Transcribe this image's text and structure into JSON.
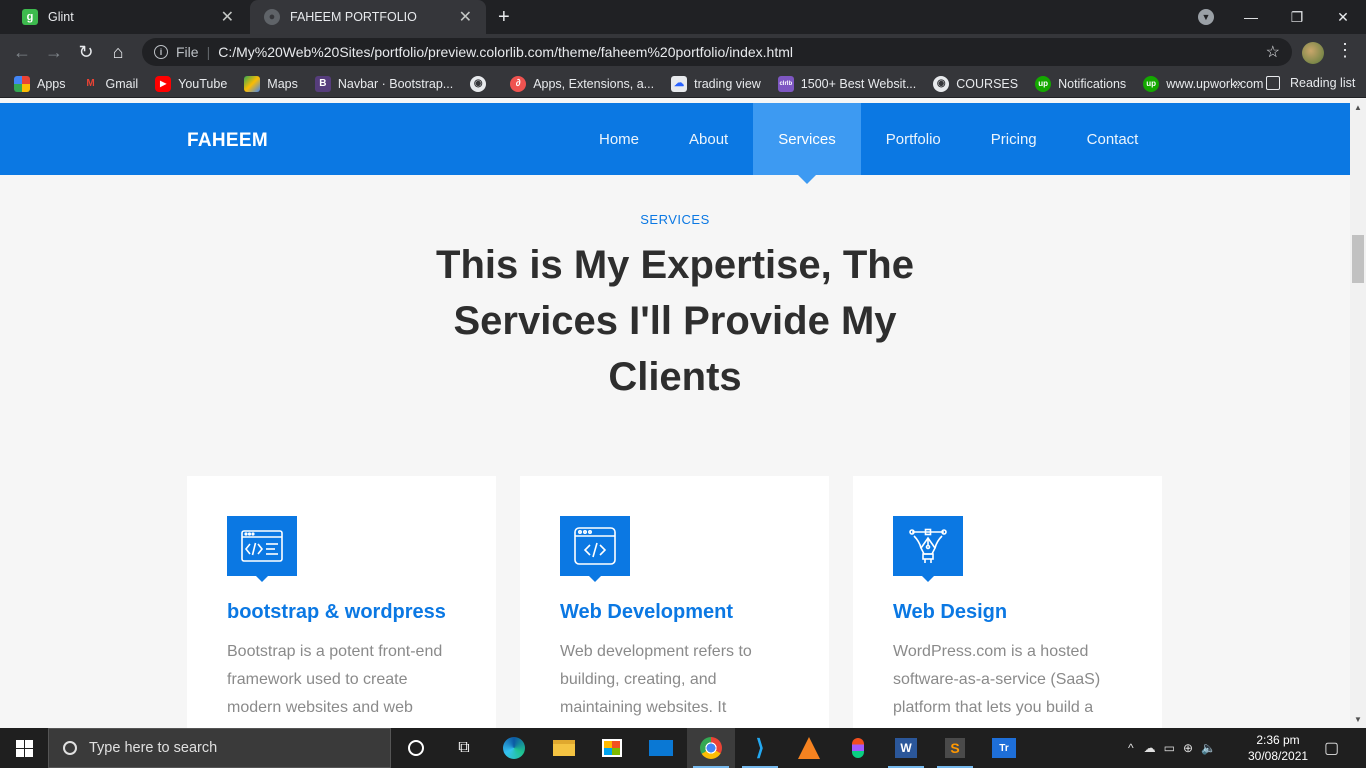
{
  "browser": {
    "tabs": [
      {
        "title": "Glint",
        "favicon": "g"
      },
      {
        "title": "FAHEEM PORTFOLIO"
      }
    ],
    "new_tab": "+",
    "window_controls": {
      "minimize": "—",
      "restore": "❐",
      "close": "✕"
    },
    "address": {
      "scheme_label": "File",
      "url": "C:/My%20Web%20Sites/portfolio/preview.colorlib.com/theme/faheem%20portfolio/index.html"
    },
    "bookmarks": [
      {
        "label": "Apps",
        "icon": "apps-grid-icon"
      },
      {
        "label": "Gmail",
        "icon": "gmail-icon"
      },
      {
        "label": "YouTube",
        "icon": "youtube-icon"
      },
      {
        "label": "Maps",
        "icon": "maps-icon"
      },
      {
        "label": "Navbar · Bootstrap...",
        "icon": "bootstrap-icon"
      },
      {
        "label": "",
        "icon": "globe-icon"
      },
      {
        "label": "Apps, Extensions, a...",
        "icon": "extensions-icon"
      },
      {
        "label": "trading view",
        "icon": "tradingview-icon"
      },
      {
        "label": "1500+ Best Websit...",
        "icon": "colorlib-icon"
      },
      {
        "label": "COURSES",
        "icon": "globe-icon"
      },
      {
        "label": "Notifications",
        "icon": "upwork-icon"
      },
      {
        "label": "www.upwork.com",
        "icon": "upwork-icon"
      }
    ],
    "bookmarks_more": "»",
    "reading_list": "Reading list"
  },
  "site": {
    "brand": "FAHEEM",
    "nav": [
      "Home",
      "About",
      "Services",
      "Portfolio",
      "Pricing",
      "Contact"
    ],
    "active_nav": "Services",
    "section_label": "SERVICES",
    "section_title": "This is My Expertise, The Services I'll Provide My Clients",
    "cards": [
      {
        "title": "bootstrap & wordpress",
        "text": "Bootstrap is a potent front-end framework used to create modern websites and web",
        "icon": "code-window-icon"
      },
      {
        "title": "Web Development",
        "text": "Web development refers to building, creating, and maintaining websites. It",
        "icon": "browser-code-icon"
      },
      {
        "title": "Web Design",
        "text": "WordPress.com is a hosted software-as-a-service (SaaS) platform that lets you build a",
        "icon": "pen-tool-icon"
      }
    ],
    "accent_color": "#0b78e3"
  },
  "taskbar": {
    "search_placeholder": "Type here to search",
    "time": "2:36 pm",
    "date": "30/08/2021"
  }
}
